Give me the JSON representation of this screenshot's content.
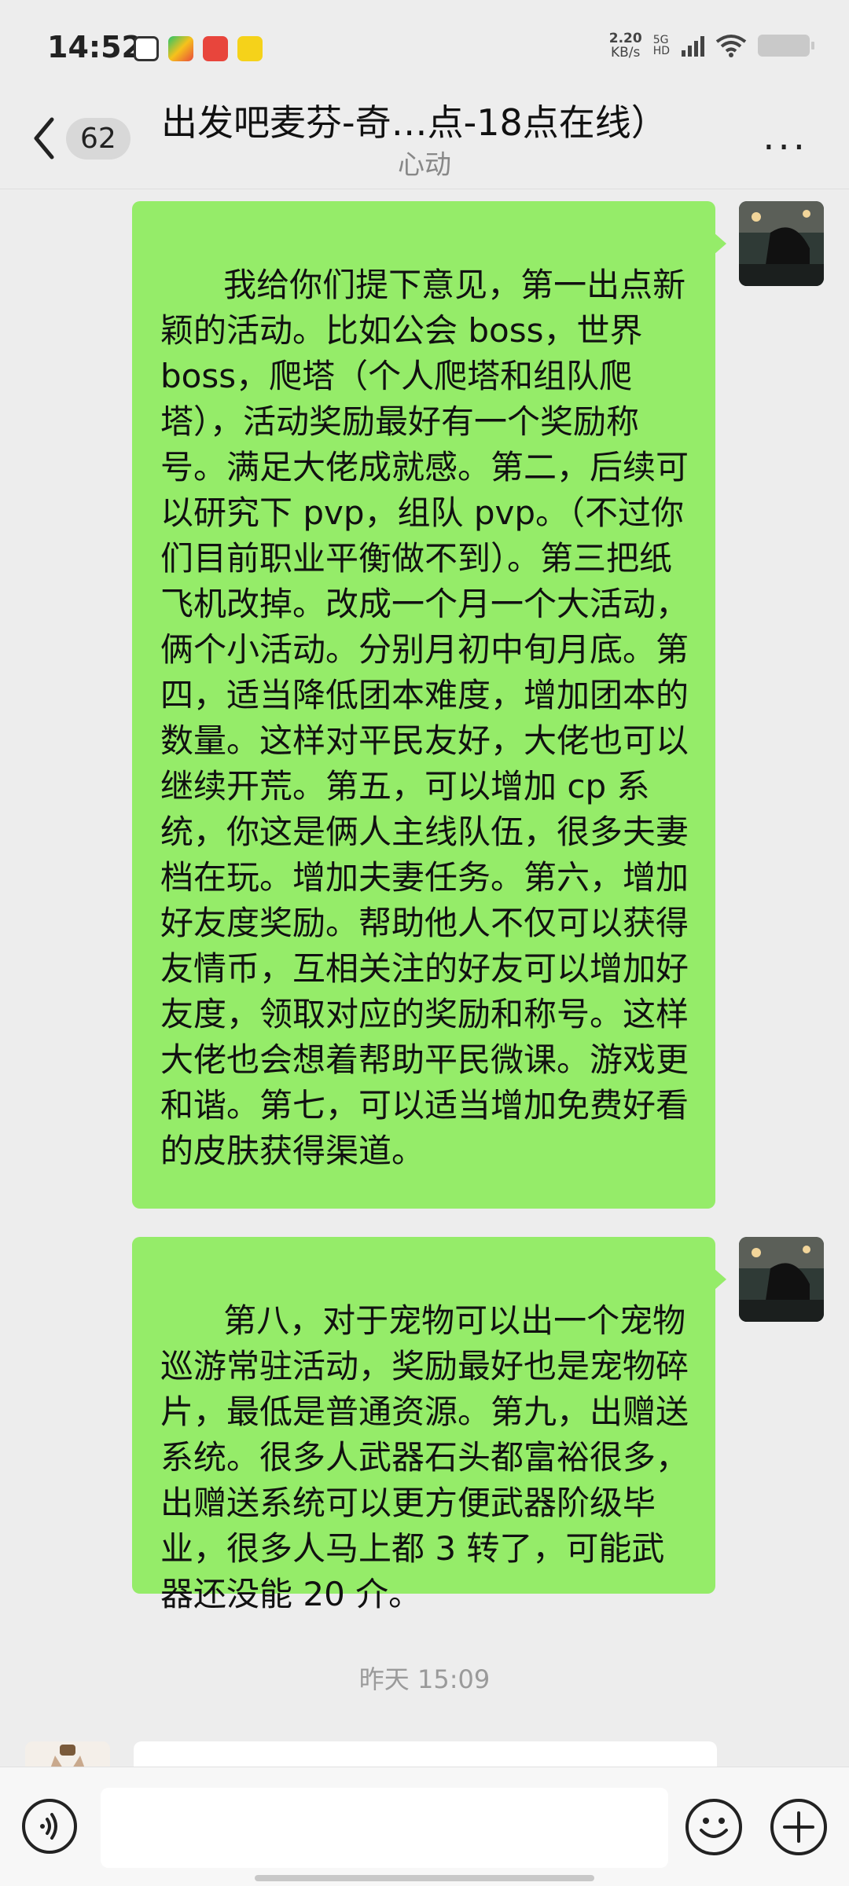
{
  "status_bar": {
    "time": "14:52",
    "net_speed_value": "2.20",
    "net_speed_unit": "KB/s",
    "signal_label_5g": "5G",
    "signal_label_hd": "HD",
    "icons": [
      "app-notification-icon",
      "video-app-icon",
      "red-app-icon",
      "yellow-app-icon",
      "signal-icon",
      "wifi-icon",
      "battery-icon"
    ]
  },
  "header": {
    "unread_count": "62",
    "title": "出发吧麦芬-奇…点-18点在线）",
    "subtitle": "心动",
    "more_label": "···"
  },
  "messages": [
    {
      "sender": "self",
      "text": "我给你们提下意见，第一出点新颖的活动。比如公会 boss，世界 boss，爬塔（个人爬塔和组队爬塔），活动奖励最好有一个奖励称号。满足大佬成就感。第二，后续可以研究下 pvp，组队 pvp。（不过你们目前职业平衡做不到）。第三把纸飞机改掉。改成一个月一个大活动，俩个小活动。分别月初中旬月底。第四，适当降低团本难度，增加团本的数量。这样对平民友好，大佬也可以继续开荒。第五，可以增加 cp 系统，你这是俩人主线队伍，很多夫妻档在玩。增加夫妻任务。第六，增加好友度奖励。帮助他人不仅可以获得友情币，互相关注的好友可以增加好友度，领取对应的奖励和称号。这样大佬也会想着帮助平民微课。游戏更和谐。第七，可以适当增加免费好看的皮肤获得渠道。"
    },
    {
      "sender": "self",
      "text": "第八，对于宠物可以出一个宠物巡游常驻活动，奖励最好也是宠物碎片，最低是普通资源。第九，出赠送系统。很多人武器石头都富裕很多，出赠送系统可以更方便武器阶级毕业，很多人马上都 3 转了，可能武器还没能 20 介。"
    }
  ],
  "timestamp": "昨天 15:09",
  "input": {
    "placeholder": ""
  },
  "colors": {
    "background": "#ededed",
    "bubble_self": "#95ec69",
    "timestamp": "#9a9a9a"
  }
}
